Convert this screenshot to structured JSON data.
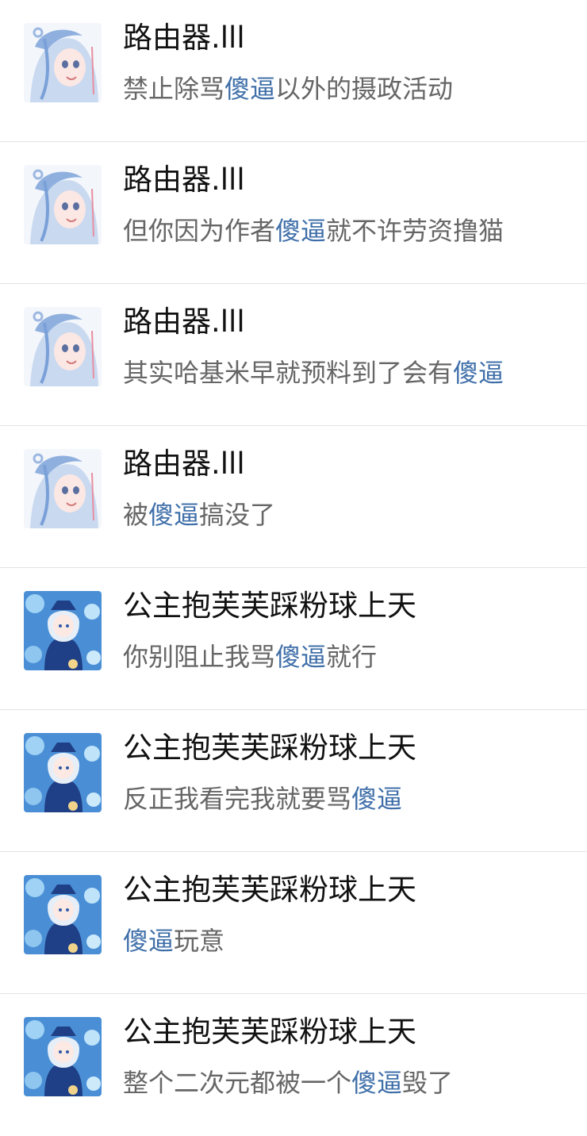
{
  "colors": {
    "name": "#111111",
    "message": "#666666",
    "keyword": "#3f6fa9",
    "divider": "#e3e3e3"
  },
  "comments": [
    {
      "user": "路由器.lll",
      "avatar_icon": "anime-avatar-icon",
      "message": {
        "before": "禁止除骂",
        "keyword": "傻逼",
        "after": "以外的摄政活动"
      }
    },
    {
      "user": "路由器.lll",
      "avatar_icon": "anime-avatar-icon",
      "message": {
        "before": "但你因为作者",
        "keyword": "傻逼",
        "after": "就不许劳资撸猫"
      }
    },
    {
      "user": "路由器.lll",
      "avatar_icon": "anime-avatar-icon",
      "message": {
        "before": "其实哈基米早就预料到了会有",
        "keyword": "傻逼",
        "after": ""
      }
    },
    {
      "user": "路由器.lll",
      "avatar_icon": "anime-avatar-icon",
      "message": {
        "before": "被",
        "keyword": "傻逼",
        "after": "搞没了"
      }
    },
    {
      "user": "公主抱芙芙踩粉球上天",
      "avatar_icon": "anime-avatar-icon",
      "message": {
        "before": "你别阻止我骂",
        "keyword": "傻逼",
        "after": "就行"
      }
    },
    {
      "user": "公主抱芙芙踩粉球上天",
      "avatar_icon": "anime-avatar-icon",
      "message": {
        "before": "反正我看完我就要骂",
        "keyword": "傻逼",
        "after": ""
      }
    },
    {
      "user": "公主抱芙芙踩粉球上天",
      "avatar_icon": "anime-avatar-icon",
      "message": {
        "before": "",
        "keyword": "傻逼",
        "after": "玩意"
      }
    },
    {
      "user": "公主抱芙芙踩粉球上天",
      "avatar_icon": "anime-avatar-icon",
      "message": {
        "before": "整个二次元都被一个",
        "keyword": "傻逼",
        "after": "毁了"
      }
    }
  ]
}
